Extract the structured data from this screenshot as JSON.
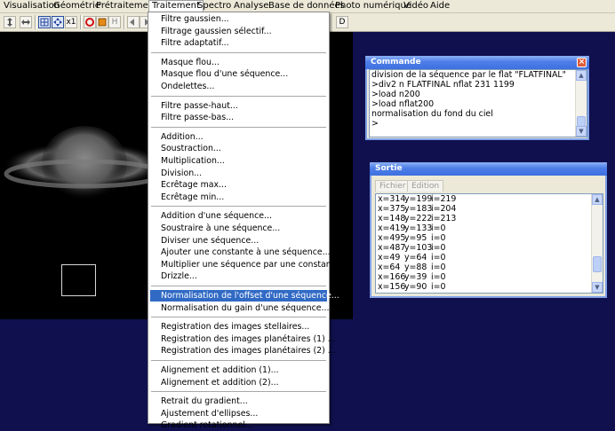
{
  "menubar": {
    "items": [
      "Visualisation",
      "Géométrie",
      "Prétraitement",
      "Traitement",
      "Spectro",
      "Analyse",
      "Base de données",
      "Photo numérique",
      "Vidéo",
      "Aide"
    ],
    "open_item": "Traitement"
  },
  "toolbar": {
    "buttons": [
      "up-down-arrows-icon",
      "left-right-arrows-icon",
      "grid-icon",
      "move-icon",
      "zoom-x1-icon",
      "red-circle-icon",
      "orange-square-icon",
      "h-icon",
      "left-arrow-icon",
      "right-arrow-icon",
      "cut-icon"
    ],
    "labels": {
      "x1": "x1",
      "h": "H",
      "d": "D"
    }
  },
  "traitement_menu": {
    "groups": [
      [
        "Filtre gaussien...",
        "Filtrage gaussien sélectif...",
        "Filtre adaptatif..."
      ],
      [
        "Masque flou...",
        "Masque flou d'une séquence...",
        "Ondelettes..."
      ],
      [
        "Filtre passe-haut...",
        "Filtre passe-bas..."
      ],
      [
        "Addition...",
        "Soustraction...",
        "Multiplication...",
        "Division...",
        "Ecrêtage max...",
        "Ecrêtage min..."
      ],
      [
        "Addition d'une séquence...",
        "Soustraire à une séquence...",
        "Diviser une séquence...",
        "Ajouter une constante à une séquence...",
        "Multiplier une séquence par une constante...",
        "Drizzle..."
      ],
      [
        "Normalisation de l'offset d'une séquence...",
        "Normalisation du gain d'une séquence..."
      ],
      [
        "Registration des images stellaires...",
        "Registration des images planétaires (1) ...",
        "Registration des images planétaires (2) ..."
      ],
      [
        "Alignement et addition (1)...",
        "Alignement et addition (2)..."
      ],
      [
        "Retrait du gradient...",
        "Ajustement d'ellipses...",
        "Gradient rotationnel..."
      ]
    ],
    "highlighted": "Normalisation de l'offset d'une séquence..."
  },
  "commande_window": {
    "title": "Commande",
    "lines": [
      "division de la séquence par le flat \"FLATFINAL\"",
      ">div2 n FLATFINAL nflat 231 1199",
      ">load n200",
      ">load nflat200",
      "normalisation du fond du ciel",
      ">"
    ]
  },
  "sortie_window": {
    "title": "Sortie",
    "tabs": [
      "Fichier",
      "Edition"
    ],
    "rows": [
      {
        "x": "x=314",
        "y": "y=199",
        "i": "i=219"
      },
      {
        "x": "x=375",
        "y": "y=183",
        "i": "i=204"
      },
      {
        "x": "x=148",
        "y": "y=222",
        "i": "i=213"
      },
      {
        "x": "x=419",
        "y": "y=133",
        "i": "i=0"
      },
      {
        "x": "x=495",
        "y": "y=95",
        "i": "i=0"
      },
      {
        "x": "x=487",
        "y": "y=103",
        "i": "i=0"
      },
      {
        "x": "x=49",
        "y": "y=64",
        "i": "i=0"
      },
      {
        "x": "x=64",
        "y": "y=88",
        "i": "i=0"
      },
      {
        "x": "x=166",
        "y": "y=39",
        "i": "i=0"
      },
      {
        "x": "x=156",
        "y": "y=90",
        "i": "i=0"
      }
    ]
  },
  "colors": {
    "desktop": "#10104e",
    "menu_highlight": "#316ac5",
    "titlebar": "#4d7ee8"
  }
}
